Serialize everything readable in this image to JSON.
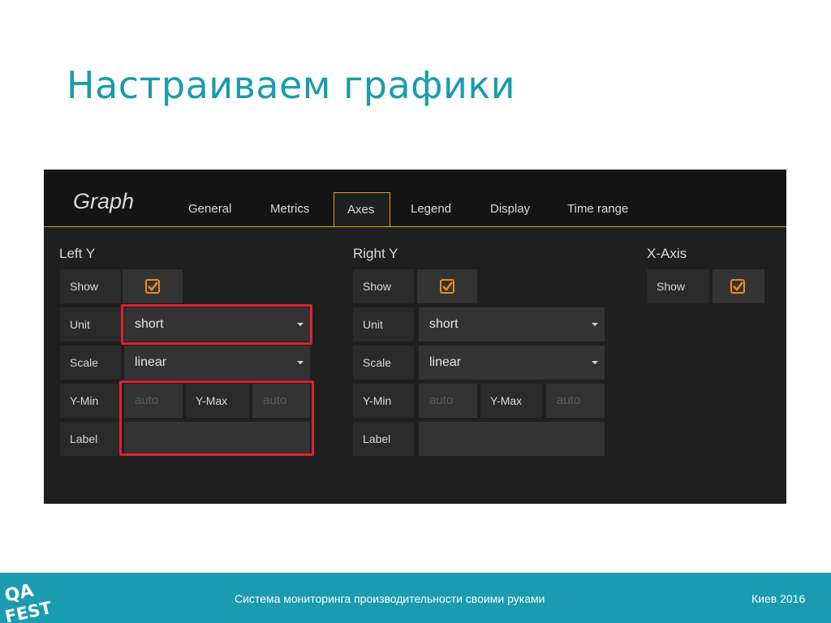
{
  "slide": {
    "title": "Настраиваем графики",
    "footer_text": "Система мониторинга производительности своими руками",
    "footer_right": "Киев 2016",
    "logo_text": "QA FEST",
    "accent_color": "#1a9bb0"
  },
  "panel": {
    "title": "Graph",
    "tabs": [
      "General",
      "Metrics",
      "Axes",
      "Legend",
      "Display",
      "Time range"
    ],
    "active_tab": "Axes"
  },
  "left_y": {
    "title": "Left Y",
    "show_label": "Show",
    "show_checked": true,
    "unit_label": "Unit",
    "unit_value": "short",
    "scale_label": "Scale",
    "scale_value": "linear",
    "ymin_label": "Y-Min",
    "ymin_placeholder": "auto",
    "ymax_label": "Y-Max",
    "ymax_placeholder": "auto",
    "label_label": "Label",
    "label_value": ""
  },
  "right_y": {
    "title": "Right Y",
    "show_label": "Show",
    "show_checked": true,
    "unit_label": "Unit",
    "unit_value": "short",
    "scale_label": "Scale",
    "scale_value": "linear",
    "ymin_label": "Y-Min",
    "ymin_placeholder": "auto",
    "ymax_label": "Y-Max",
    "ymax_placeholder": "auto",
    "label_label": "Label",
    "label_value": ""
  },
  "x_axis": {
    "title": "X-Axis",
    "show_label": "Show",
    "show_checked": true
  }
}
